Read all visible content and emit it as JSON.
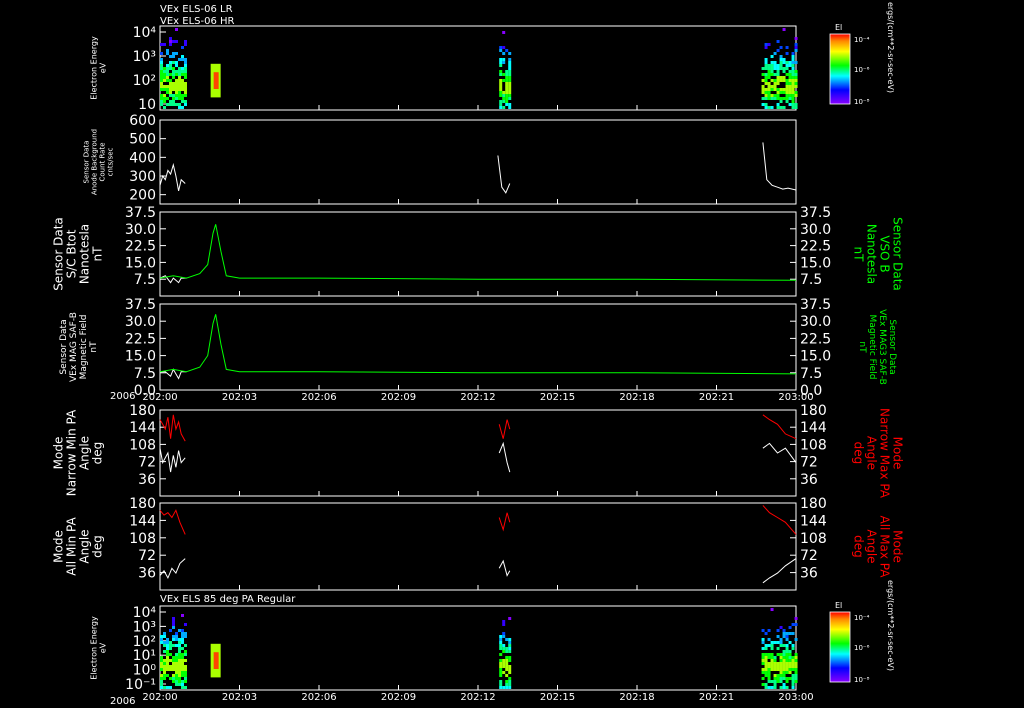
{
  "header": {
    "title_lr": "VEx ELS-06 LR",
    "title_hr": "VEx ELS-06 HR",
    "bottom_title": "VEx ELS 85 deg PA Regular"
  },
  "time_axis": {
    "year": "2006",
    "ticks": [
      "202:00",
      "202:03",
      "202:06",
      "202:09",
      "202:12",
      "202:15",
      "202:18",
      "202:21",
      "203:00"
    ]
  },
  "colorbar": {
    "label": "El",
    "units": "ergs/(cm**2-sr-sec-eV)",
    "tick_top": "10⁻⁴",
    "tick_mid": "10⁻⁶",
    "tick_bot": "10⁻⁸"
  },
  "chart_data": [
    {
      "type": "heatmap",
      "ylabel": [
        "Electron Energy",
        "eV"
      ],
      "yscale": "log",
      "yticks": [
        "10⁴",
        "10³",
        "10²",
        "10"
      ],
      "data_intervals_hours": [
        [
          0.0,
          0.95
        ],
        [
          12.8,
          13.2
        ],
        [
          22.7,
          24.0
        ]
      ],
      "peak_hour": 2.1
    },
    {
      "type": "line",
      "ylabel": [
        "Sensor Data",
        "Anode Background",
        "Count Rate",
        "cnts/sec"
      ],
      "ylim": [
        150,
        600
      ],
      "yticks": [
        "600",
        "500",
        "400",
        "300",
        "200"
      ],
      "series": [
        {
          "color": "#ffffff",
          "segments": [
            {
              "t": [
                0.0,
                0.1,
                0.2,
                0.3,
                0.4,
                0.5,
                0.6,
                0.7,
                0.8,
                0.95
              ],
              "v": [
                250,
                300,
                280,
                330,
                310,
                360,
                300,
                220,
                280,
                260
              ]
            },
            {
              "t": [
                12.75,
                12.9,
                13.05,
                13.2
              ],
              "v": [
                410,
                240,
                210,
                260
              ]
            },
            {
              "t": [
                22.75,
                22.9,
                23.1,
                23.3,
                23.5,
                23.7,
                24.0
              ],
              "v": [
                480,
                280,
                250,
                240,
                230,
                235,
                225
              ]
            }
          ]
        }
      ]
    },
    {
      "type": "line",
      "ylabel_left": [
        "Sensor Data",
        "S/C Btot",
        "Nanotesla",
        "nT"
      ],
      "ylabel_right": [
        "Sensor Data",
        "VSO B",
        "Nanotesla",
        "nT"
      ],
      "ylim": [
        0,
        37.5
      ],
      "yticks": [
        "37.5",
        "30.0",
        "22.5",
        "15.0",
        "7.5"
      ],
      "series": [
        {
          "color": "#ffffff",
          "t": [
            0.0,
            0.2,
            0.4,
            0.5,
            0.6,
            0.7,
            0.8,
            1.0
          ],
          "v": [
            8,
            9,
            6,
            8,
            7,
            6,
            8,
            8
          ]
        },
        {
          "color": "#00ff00",
          "t": [
            0.0,
            0.5,
            1.0,
            1.5,
            1.8,
            2.0,
            2.1,
            2.3,
            2.5,
            3.0,
            6.0,
            12.0,
            18.0,
            24.0
          ],
          "v": [
            8,
            9,
            8,
            10,
            14,
            28,
            32,
            20,
            9,
            8,
            8,
            7.5,
            7.5,
            7
          ]
        }
      ]
    },
    {
      "type": "line",
      "ylabel_left": [
        "Sensor Data",
        "VEx MAG SAF-B",
        "Magnetic Field",
        "nT"
      ],
      "ylabel_right": [
        "Sensor Data",
        "VEx MAG3 SAF-B",
        "Magnetic Field",
        "nT"
      ],
      "ylim": [
        0,
        37.5
      ],
      "yticks": [
        "37.5",
        "30.0",
        "22.5",
        "15.0",
        "7.5",
        "0.0"
      ],
      "series": [
        {
          "color": "#ffffff",
          "t": [
            0.0,
            0.2,
            0.4,
            0.5,
            0.6,
            0.7,
            0.8,
            1.0
          ],
          "v": [
            8,
            8,
            6,
            9,
            7,
            5,
            8,
            8
          ]
        },
        {
          "color": "#00ff00",
          "t": [
            0.0,
            0.5,
            1.0,
            1.5,
            1.8,
            2.0,
            2.1,
            2.3,
            2.5,
            3.0,
            6.0,
            12.0,
            18.0,
            24.0
          ],
          "v": [
            8,
            9,
            8,
            10,
            15,
            29,
            33,
            20,
            9,
            8,
            8,
            7.5,
            7.5,
            7
          ]
        }
      ]
    },
    {
      "type": "line",
      "ylabel_left": [
        "Mode",
        "Narrow Min PA",
        "Angle",
        "deg"
      ],
      "ylabel_right": [
        "Mode",
        "Narrow Max PA",
        "Angle",
        "deg"
      ],
      "ylim": [
        0,
        180
      ],
      "yticks": [
        "180",
        "144",
        "108",
        "72",
        "36"
      ],
      "series": [
        {
          "color": "#ff0000",
          "segments": [
            {
              "t": [
                0.0,
                0.1,
                0.2,
                0.3,
                0.4,
                0.5,
                0.6,
                0.7,
                0.8,
                0.95
              ],
              "v": [
                160,
                150,
                140,
                165,
                120,
                170,
                140,
                155,
                130,
                115
              ]
            },
            {
              "t": [
                12.8,
                12.95,
                13.1,
                13.2
              ],
              "v": [
                150,
                120,
                160,
                140
              ]
            },
            {
              "t": [
                22.75,
                23.0,
                23.3,
                23.6,
                24.0
              ],
              "v": [
                170,
                160,
                150,
                130,
                120
              ]
            }
          ]
        },
        {
          "color": "#ffffff",
          "segments": [
            {
              "t": [
                0.0,
                0.1,
                0.2,
                0.3,
                0.4,
                0.5,
                0.6,
                0.7,
                0.8,
                0.95
              ],
              "v": [
                100,
                70,
                80,
                90,
                50,
                85,
                60,
                95,
                70,
                80
              ]
            },
            {
              "t": [
                12.8,
                12.95,
                13.1,
                13.2
              ],
              "v": [
                90,
                110,
                70,
                50
              ]
            },
            {
              "t": [
                22.75,
                23.0,
                23.3,
                23.6,
                24.0
              ],
              "v": [
                100,
                110,
                90,
                100,
                70
              ]
            }
          ]
        }
      ]
    },
    {
      "type": "line",
      "ylabel_left": [
        "Mode",
        "All Min PA",
        "Angle",
        "deg"
      ],
      "ylabel_right": [
        "Mode",
        "All Max PA",
        "Angle",
        "deg"
      ],
      "ylim": [
        0,
        180
      ],
      "yticks": [
        "180",
        "144",
        "108",
        "72",
        "36"
      ],
      "series": [
        {
          "color": "#ff0000",
          "segments": [
            {
              "t": [
                0.0,
                0.15,
                0.3,
                0.45,
                0.6,
                0.75,
                0.95
              ],
              "v": [
                165,
                155,
                160,
                150,
                165,
                140,
                115
              ]
            },
            {
              "t": [
                12.8,
                12.95,
                13.1,
                13.2
              ],
              "v": [
                150,
                125,
                160,
                140
              ]
            },
            {
              "t": [
                22.75,
                23.0,
                23.3,
                23.6,
                24.0
              ],
              "v": [
                175,
                160,
                150,
                140,
                115
              ]
            }
          ]
        },
        {
          "color": "#ffffff",
          "segments": [
            {
              "t": [
                0.0,
                0.15,
                0.3,
                0.45,
                0.6,
                0.75,
                0.95
              ],
              "v": [
                30,
                40,
                25,
                45,
                35,
                55,
                65
              ]
            },
            {
              "t": [
                12.8,
                12.95,
                13.1,
                13.2
              ],
              "v": [
                45,
                60,
                30,
                40
              ]
            },
            {
              "t": [
                22.75,
                23.0,
                23.3,
                23.6,
                24.0
              ],
              "v": [
                15,
                25,
                35,
                50,
                65
              ]
            }
          ]
        }
      ]
    },
    {
      "type": "heatmap",
      "ylabel": [
        "Electron Energy",
        "eV"
      ],
      "yscale": "log",
      "yticks": [
        "10⁴",
        "10³",
        "10²",
        "10¹",
        "10⁰",
        "10⁻¹"
      ],
      "data_intervals_hours": [
        [
          0.0,
          0.95
        ],
        [
          12.8,
          13.2
        ],
        [
          22.7,
          24.0
        ]
      ],
      "peak_hour": 2.1
    }
  ]
}
